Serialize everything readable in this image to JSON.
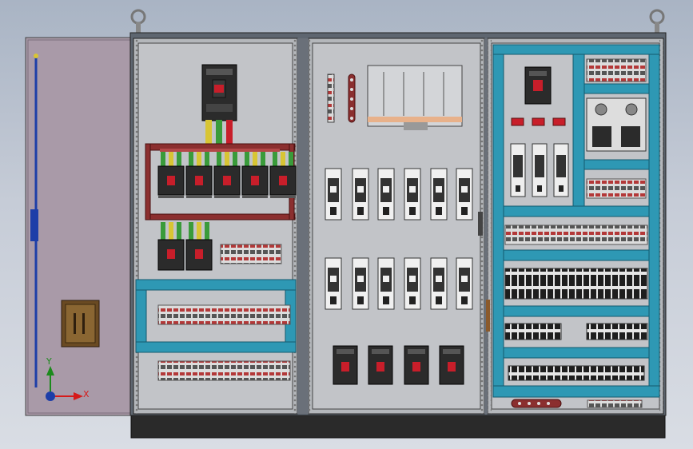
{
  "viewport": {
    "axis_labels": {
      "x": "X",
      "y": "Y"
    }
  },
  "colors": {
    "frame": "#5e6670",
    "panel": "#bfc2c6",
    "door": "#a99aa8",
    "rail": "#2e98b4",
    "busbar": "#8b2f2f",
    "breaker": "#2b2b2b",
    "breaker_red": "#c81e2a",
    "wire_green": "#3a9b3a",
    "wire_yellow": "#d8c534",
    "plinth": "#2a2a2a",
    "handle": "#1d3ea8",
    "axis_x": "#d61a1a",
    "axis_y": "#1c8a1c",
    "axis_z": "#1d3ea8"
  },
  "components": {
    "lifting_eyes": 2,
    "mccb_branch_row1": 5,
    "mccb_branch_row2": 2,
    "fuse_holders_row1": 6,
    "fuse_holders_row2": 6,
    "mccb_bottom_row": 4,
    "relays_right": 3
  }
}
